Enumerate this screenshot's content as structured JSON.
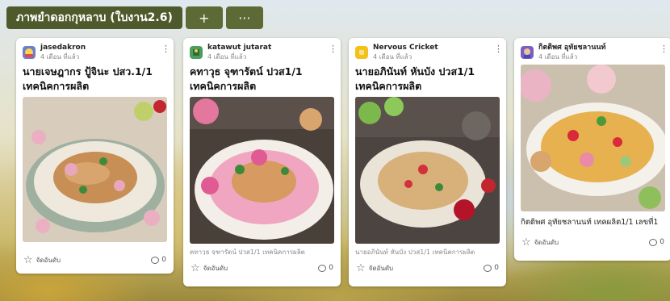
{
  "board": {
    "title": "ภาพยำดอกกุหลาบ (ใบงาน2.6)",
    "add_label": "+",
    "more_label": "···"
  },
  "posts": [
    {
      "author": "jasedakron",
      "time": "4 เดือน ที่แล้ว",
      "title": "นายเจษฎากร ปู้จินะ ปสว.1/1 เทคนิคการผลิต",
      "caption": "",
      "rank_label": "จัดอันดับ",
      "comments": "0",
      "avatar_color": "#6b7fd1",
      "rank_icon": "star-outline",
      "comment_icon": "speech-bubble"
    },
    {
      "author": "katawut jutarat",
      "time": "4 เดือน ที่แล้ว",
      "title": "คทาวุธ จุฑารัตน์ ปวส1/1 เทคนิคการผลิต",
      "caption": "คทาวุธ จุฑารัตน์ ปวส1/1 เทคนิคการผลิต",
      "rank_label": "จัดอันดับ",
      "comments": "0",
      "avatar_color": "#4aa05a"
    },
    {
      "author": "Nervous Cricket",
      "time": "4 เดือน ที่แล้ว",
      "title": "นายอภินันท์ หันบัง ปวส1/1 เทคนิคการผลิต",
      "caption": "นายอภินันท์ หันบัง ปวส1/1 เทคนิคการผลิต",
      "rank_label": "จัดอันดับ",
      "comments": "0",
      "avatar_color": "#f2c21a"
    },
    {
      "author": "กิตติพศ อุทัยชลานนท์",
      "time": "4 เดือน ที่แล้ว",
      "title": "",
      "caption": "กิตติพศ อุทัยชลานนท์ เทคผลิต1/1 เลขที่1",
      "rank_label": "จัดอันดับ",
      "comments": "0",
      "avatar_color": "#7a5fc0"
    }
  ]
}
